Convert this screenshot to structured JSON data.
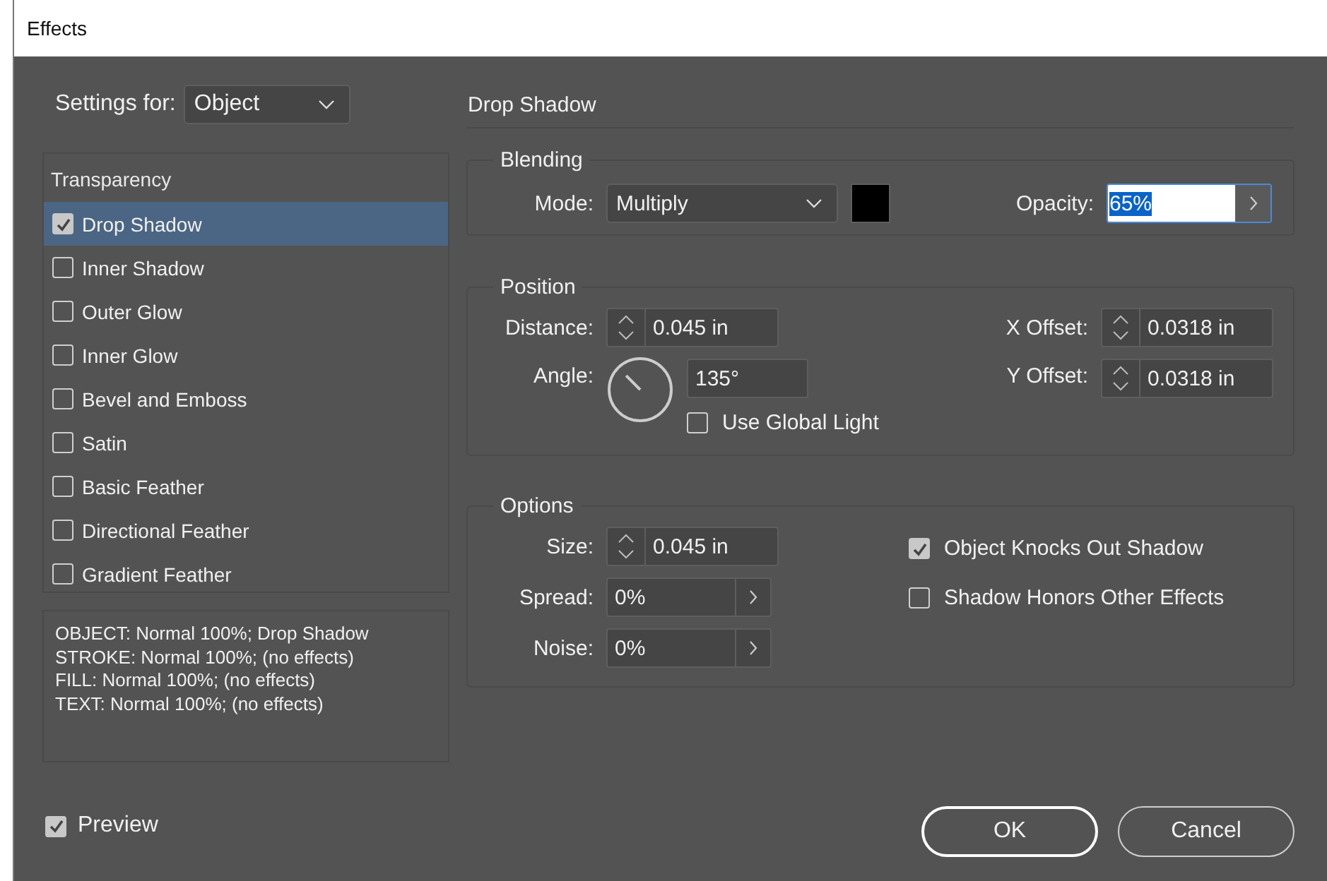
{
  "window": {
    "title": "Effects"
  },
  "settings_for": {
    "label": "Settings for:",
    "value": "Object"
  },
  "effects_list": {
    "heading": "Transparency",
    "items": [
      {
        "label": "Drop Shadow",
        "checked": true,
        "selected": true
      },
      {
        "label": "Inner Shadow",
        "checked": false,
        "selected": false
      },
      {
        "label": "Outer Glow",
        "checked": false,
        "selected": false
      },
      {
        "label": "Inner Glow",
        "checked": false,
        "selected": false
      },
      {
        "label": "Bevel and Emboss",
        "checked": false,
        "selected": false
      },
      {
        "label": "Satin",
        "checked": false,
        "selected": false
      },
      {
        "label": "Basic Feather",
        "checked": false,
        "selected": false
      },
      {
        "label": "Directional Feather",
        "checked": false,
        "selected": false
      },
      {
        "label": "Gradient Feather",
        "checked": false,
        "selected": false
      }
    ]
  },
  "summary": [
    "OBJECT: Normal 100%; Drop Shadow",
    "STROKE: Normal 100%; (no effects)",
    "FILL: Normal 100%; (no effects)",
    "TEXT: Normal 100%; (no effects)"
  ],
  "preview": {
    "label": "Preview",
    "checked": true
  },
  "panel": {
    "title": "Drop Shadow"
  },
  "blending": {
    "title": "Blending",
    "mode_label": "Mode:",
    "mode": "Multiply",
    "color": "#000000",
    "opacity_label": "Opacity:",
    "opacity": "65%"
  },
  "position": {
    "title": "Position",
    "distance": {
      "label": "Distance:",
      "value": "0.045 in"
    },
    "angle": {
      "label": "Angle:",
      "value": "135°"
    },
    "use_global_light": {
      "label": "Use Global Light",
      "checked": false
    },
    "x_offset": {
      "label": "X Offset:",
      "value": "0.0318 in"
    },
    "y_offset": {
      "label": "Y Offset:",
      "value": "0.0318 in"
    }
  },
  "options": {
    "title": "Options",
    "size": {
      "label": "Size:",
      "value": "0.045 in"
    },
    "spread": {
      "label": "Spread:",
      "value": "0%"
    },
    "noise": {
      "label": "Noise:",
      "value": "0%"
    },
    "knocks_out": {
      "label": "Object Knocks Out Shadow",
      "checked": true
    },
    "honors_effects": {
      "label": "Shadow Honors Other Effects",
      "checked": false
    }
  },
  "buttons": [
    {
      "label": "OK",
      "kind": "default"
    },
    {
      "label": "Cancel",
      "kind": "normal"
    }
  ]
}
